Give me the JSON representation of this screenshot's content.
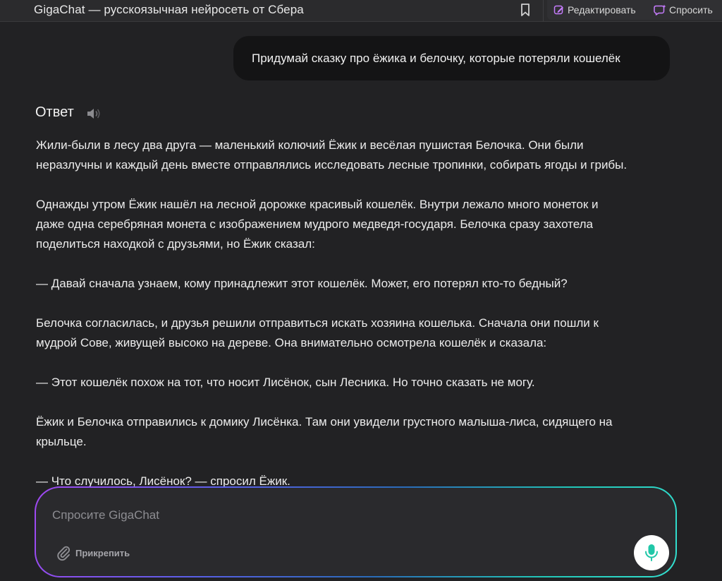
{
  "header": {
    "title": "GigaChat — русскоязычная нейросеть от Сбера",
    "bookmark_icon": "bookmark-icon",
    "edit_label": "Редактировать",
    "ask_label": "Спросить",
    "accent_color": "#c77dff"
  },
  "chat": {
    "user_message": "Придумай сказку про ёжика и белочку, которые потеряли кошелёк",
    "answer_heading": "Ответ",
    "speaker_icon": "speaker-icon",
    "paragraphs": [
      "Жили-были в лесу два друга — маленький колючий Ёжик и весёлая пушистая Белочка. Они были\nнеразлучны и каждый день вместе отправлялись исследовать лесные тропинки, собирать ягоды и грибы.",
      "Однажды утром Ёжик нашёл на лесной дорожке красивый кошелёк. Внутри лежало много монеток и\nдаже одна серебряная монета с изображением мудрого медведя-государя. Белочка сразу захотела\nподелиться находкой с друзьями, но Ёжик сказал:",
      "— Давай сначала узнаем, кому принадлежит этот кошелёк. Может, его потерял кто-то бедный?",
      "Белочка согласилась, и друзья решили отправиться искать хозяина кошелька. Сначала они пошли к\nмудрой Сове, живущей высоко на дереве. Она внимательно осмотрела кошелёк и сказала:",
      "— Этот кошелёк похож на тот, что носит Лисёнок, сын Лесника. Но точно сказать не могу.",
      "Ёжик и Белочка отправились к домику Лисёнка. Там они увидели грустного малыша-лиса, сидящего на\nкрыльце.",
      "— Что случилось, Лисёнок? — спросил Ёжик."
    ]
  },
  "composer": {
    "placeholder": "Спросите GigaChat",
    "value": "",
    "attach_label": "Прикрепить",
    "mic_color": "#21c7a8"
  }
}
